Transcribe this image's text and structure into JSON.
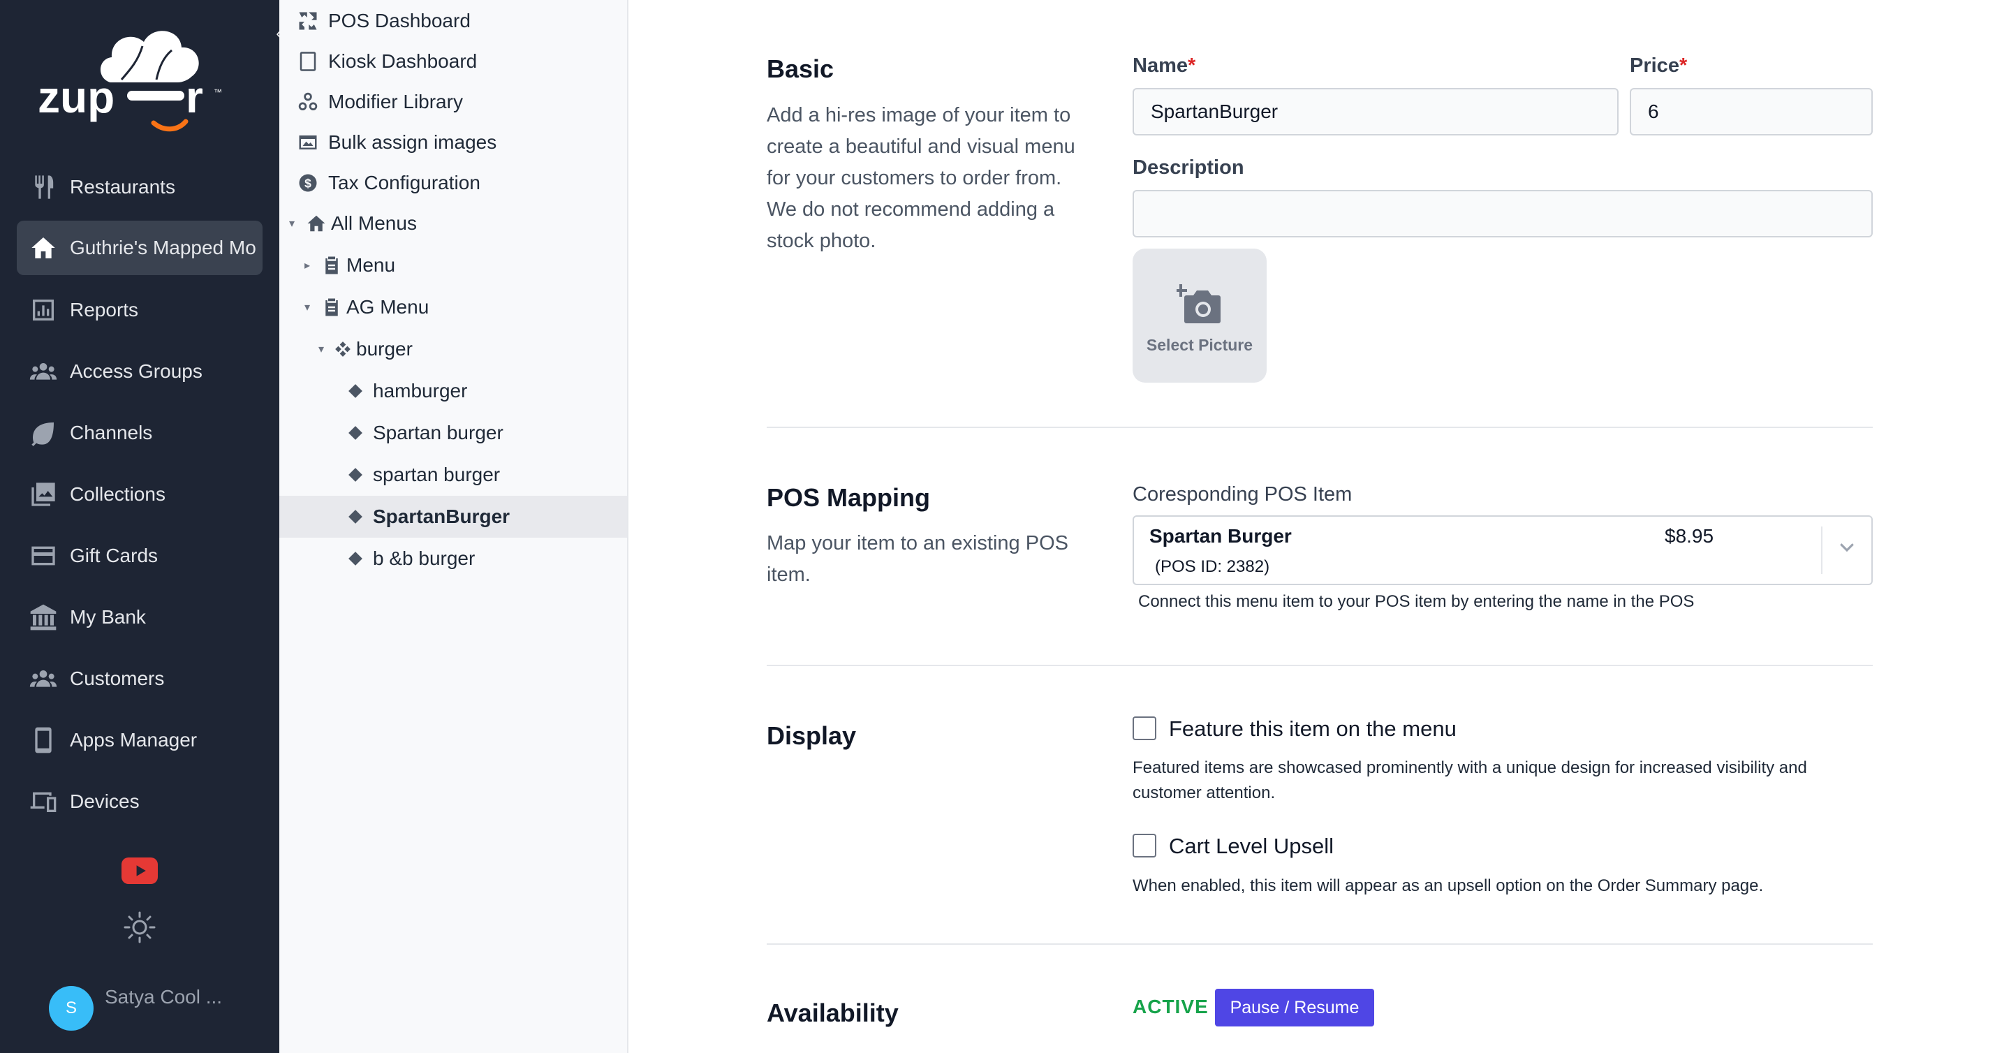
{
  "brand": {
    "logo_text": "zup r",
    "logo_tm": "™"
  },
  "nav": {
    "items": [
      {
        "label": "Restaurants",
        "icon": "fork-knife-icon"
      },
      {
        "label": "Guthrie's Mapped Mo",
        "icon": "home-icon",
        "active": true
      },
      {
        "label": "Reports",
        "icon": "bar-chart-icon"
      },
      {
        "label": "Access Groups",
        "icon": "users-icon"
      },
      {
        "label": "Channels",
        "icon": "leaf-icon"
      },
      {
        "label": "Collections",
        "icon": "images-icon"
      },
      {
        "label": "Gift Cards",
        "icon": "credit-card-icon"
      },
      {
        "label": "My Bank",
        "icon": "bank-icon"
      },
      {
        "label": "Customers",
        "icon": "users-icon"
      },
      {
        "label": "Apps Manager",
        "icon": "mobile-icon"
      },
      {
        "label": "Devices",
        "icon": "devices-icon"
      }
    ],
    "collapse_glyph": "‹",
    "user": {
      "initial": "S",
      "name": "Satya Cool ..."
    }
  },
  "tree": {
    "items": [
      {
        "label": "POS Dashboard",
        "icon": "dashboard-icon"
      },
      {
        "label": "Kiosk Dashboard",
        "icon": "tablet-icon"
      },
      {
        "label": "Modifier Library",
        "icon": "modifier-icon"
      },
      {
        "label": "Bulk assign images",
        "icon": "image-icon"
      },
      {
        "label": "Tax Configuration",
        "icon": "dollar-circle-icon"
      },
      {
        "label": "All Menus",
        "icon": "home-icon"
      },
      {
        "label": "Menu",
        "icon": "clipboard-icon"
      },
      {
        "label": "AG Menu",
        "icon": "clipboard-icon"
      },
      {
        "label": "burger",
        "icon": "category-icon"
      },
      {
        "label": "hamburger"
      },
      {
        "label": "Spartan burger"
      },
      {
        "label": "spartan burger"
      },
      {
        "label": "SpartanBurger",
        "selected": true
      },
      {
        "label": "b &b burger"
      }
    ]
  },
  "basic": {
    "title": "Basic",
    "description": "Add a hi-res image of your item to create a beautiful and visual menu for your customers to order from. We do not recommend adding a stock photo.",
    "name_label": "Name",
    "name_value": "SpartanBurger",
    "price_label": "Price",
    "price_value": "6",
    "required_mark": "*",
    "description_label": "Description",
    "description_value": "",
    "select_picture_label": "Select Picture"
  },
  "pos_mapping": {
    "title": "POS Mapping",
    "description": "Map your item to an existing POS item.",
    "field_label": "Coresponding POS Item",
    "selected_name": "Spartan Burger",
    "selected_price": "$8.95",
    "selected_id": "(POS ID: 2382)",
    "hint": "Connect this menu item to your POS item by entering the name in the POS"
  },
  "display": {
    "title": "Display",
    "feature_label": "Feature this item on the menu",
    "feature_checked": false,
    "feature_hint": "Featured items are showcased prominently with a unique design for increased visibility and customer attention.",
    "upsell_label": "Cart Level Upsell",
    "upsell_checked": false,
    "upsell_hint": "When enabled, this item will appear as an upsell option on the Order Summary page."
  },
  "availability": {
    "title": "Availability",
    "status": "ACTIVE",
    "button_label": "Pause / Resume"
  },
  "colors": {
    "nav_bg": "#1e2534",
    "accent": "#4f46e5",
    "active_status": "#16a34a",
    "required": "#dc2626",
    "logo_smile": "#f97316"
  }
}
